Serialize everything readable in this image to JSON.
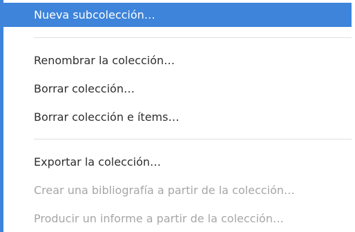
{
  "menu": {
    "items": [
      {
        "label": "Nueva subcolección…",
        "state": "highlighted"
      },
      {
        "label": "Renombrar la colección…",
        "state": "enabled"
      },
      {
        "label": "Borrar colección…",
        "state": "enabled"
      },
      {
        "label": "Borrar colección e ítems…",
        "state": "enabled"
      },
      {
        "label": "Exportar la colección…",
        "state": "enabled"
      },
      {
        "label": "Crear una bibliografía a partir de la colección…",
        "state": "disabled"
      },
      {
        "label": "Producir un informe a partir de la colección…",
        "state": "disabled"
      }
    ],
    "colors": {
      "highlight": "#3d84da",
      "text": "#2e2e2e",
      "disabled_text": "#a6a6a6",
      "separator": "#e0e0e0"
    }
  }
}
